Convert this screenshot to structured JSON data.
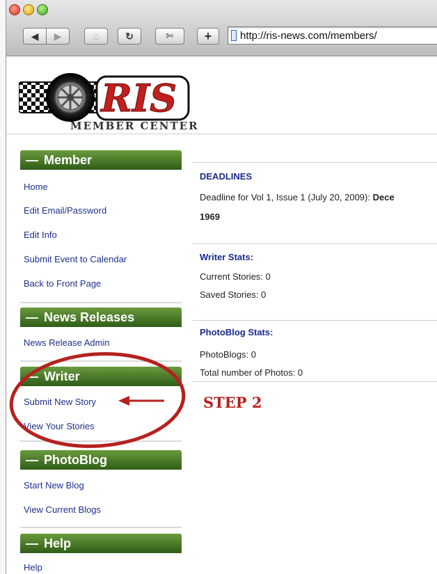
{
  "browser": {
    "url": "http://ris-news.com/members/",
    "buttons": {
      "back": "◀",
      "forward": "▶",
      "home": "⌂",
      "reload": "↻",
      "snip": "✄",
      "add": "+"
    }
  },
  "logo": {
    "brand": "RIS",
    "subtitle": "Member Center"
  },
  "sidebar": {
    "sections": [
      {
        "title": "Member",
        "links": [
          "Home",
          "Edit Email/Password",
          "Edit Info",
          "Submit Event to Calendar",
          "Back to Front Page"
        ]
      },
      {
        "title": "News Releases",
        "links": [
          "News Release Admin"
        ]
      },
      {
        "title": "Writer",
        "links": [
          "Submit New Story",
          "View Your Stories"
        ]
      },
      {
        "title": "PhotoBlog",
        "links": [
          "Start New Blog",
          "View Current Blogs"
        ]
      },
      {
        "title": "Help",
        "links": [
          "Help"
        ]
      }
    ]
  },
  "main": {
    "deadlines": {
      "heading": "DEADLINES",
      "line_prefix": "Deadline for Vol 1, Issue 1 (July 20, 2009): ",
      "line_bold": "Dece",
      "line2": "1969"
    },
    "writer_stats": {
      "heading": "Writer Stats:",
      "current": "Current Stories: 0",
      "saved": "Saved Stories: 0"
    },
    "photoblog_stats": {
      "heading": "PhotoBlog Stats:",
      "blogs": "PhotoBlogs: 0",
      "photos": "Total number of Photos: 0"
    }
  },
  "annotation": {
    "step_label": "STEP 2",
    "color": "#b5211f"
  }
}
